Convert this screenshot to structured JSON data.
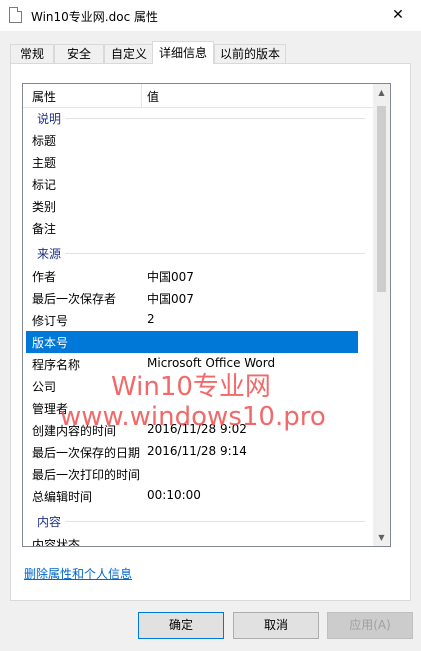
{
  "window": {
    "title": "Win10专业网.doc 属性",
    "close_glyph": "✕"
  },
  "tabs": [
    {
      "label": "常规"
    },
    {
      "label": "安全"
    },
    {
      "label": "自定义"
    },
    {
      "label": "详细信息"
    },
    {
      "label": "以前的版本"
    }
  ],
  "list": {
    "header": {
      "property": "属性",
      "value": "值"
    },
    "groups": [
      {
        "label": "说明"
      },
      {
        "label": "来源"
      },
      {
        "label": "内容"
      }
    ],
    "rows": [
      {
        "name": "标题",
        "value": ""
      },
      {
        "name": "主题",
        "value": ""
      },
      {
        "name": "标记",
        "value": ""
      },
      {
        "name": "类别",
        "value": ""
      },
      {
        "name": "备注",
        "value": ""
      },
      {
        "name": "作者",
        "value": "中国007"
      },
      {
        "name": "最后一次保存者",
        "value": "中国007"
      },
      {
        "name": "修订号",
        "value": "2"
      },
      {
        "name": "版本号",
        "value": ""
      },
      {
        "name": "程序名称",
        "value": "Microsoft Office Word"
      },
      {
        "name": "公司",
        "value": ""
      },
      {
        "name": "管理者",
        "value": ""
      },
      {
        "name": "创建内容的时间",
        "value": "2016/11/28 9:02"
      },
      {
        "name": "最后一次保存的日期",
        "value": "2016/11/28 9:14"
      },
      {
        "name": "最后一次打印的时间",
        "value": ""
      },
      {
        "name": "总编辑时间",
        "value": "00:10:00"
      },
      {
        "name": "内容状态",
        "value": ""
      }
    ],
    "selected_row": "版本号"
  },
  "remove_link": "删除属性和个人信息",
  "buttons": {
    "ok": "确定",
    "cancel": "取消",
    "apply": "应用(A)"
  },
  "watermark": {
    "line1": "Win10专业网",
    "line2": "www.windows10.pro"
  },
  "colors": {
    "accent": "#0078d7",
    "group_label": "#1e3287",
    "link": "#0066cc",
    "watermark": "#f05050"
  }
}
